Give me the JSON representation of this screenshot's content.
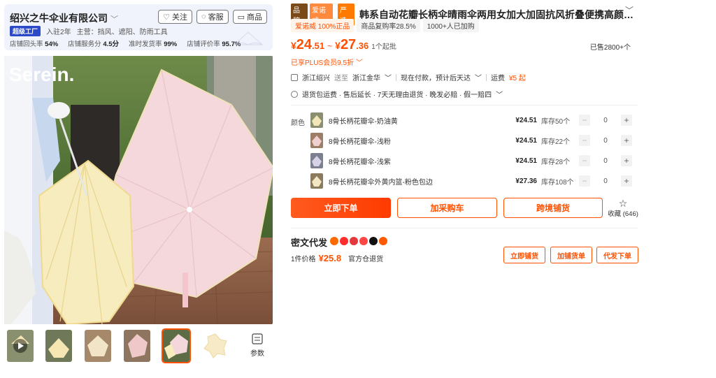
{
  "shop": {
    "name": "绍兴之牛伞业有限公司",
    "follow_label": "关注",
    "service_label": "客服",
    "store_label": "商品",
    "badge": "超级工厂",
    "years": "入驻2年",
    "main_business": "主营：挡风、遮阳、防雨工具",
    "stats": [
      {
        "label": "店铺回头率",
        "value": "54%"
      },
      {
        "label": "店铺服务分",
        "value": "4.5分"
      },
      {
        "label": "准时发货率",
        "value": "99%"
      },
      {
        "label": "店铺评价率",
        "value": "95.7%"
      }
    ]
  },
  "gallery": {
    "watermark": "Serein.",
    "param_label": "参数",
    "active_thumb": 4
  },
  "product": {
    "tag_brand": "品牌",
    "tag_brandname": "爱诺威",
    "tag_yanxuan": "严选",
    "title": "韩系自动花瓣长柄伞晴雨伞两用女加大加固抗风折叠便携高颜…",
    "chips": [
      "爱诺威 100%正品",
      "商品复购率28.5%",
      "1000+人已加购"
    ],
    "price_low_int": "24",
    "price_low_dec": ".51",
    "price_high_int": "27",
    "price_high_dec": ".36",
    "price_symbol": "¥",
    "price_sep": "~",
    "moq": "1个起批",
    "sold": "已售2800+个",
    "plus_text": "已享PLUS会员9.5折"
  },
  "logistics": {
    "from": "浙江绍兴",
    "to_prefix": "送至",
    "to": "浙江金华",
    "delivery": "现在付款，预计后天达",
    "shipping_label": "运费",
    "shipping_value": "¥5 起",
    "services": "退货包运费 · 售后延长 · 7天无理由退货 · 晚发必赔 · 假一赔四"
  },
  "sku": {
    "label": "颜色",
    "items": [
      {
        "name": "8骨长柄花瓣伞-奶油黄",
        "price": "¥24.51",
        "stock": "库存50个",
        "qty": "0",
        "color": "#f3e6b8"
      },
      {
        "name": "8骨长柄花瓣伞-浅粉",
        "price": "¥24.51",
        "stock": "库存22个",
        "qty": "0",
        "color": "#f0cfcf"
      },
      {
        "name": "8骨长柄花瓣伞-浅紫",
        "price": "¥24.51",
        "stock": "库存28个",
        "qty": "0",
        "color": "#d8d2e6"
      },
      {
        "name": "8骨长柄花瓣伞外黄内篮-粉色包边",
        "price": "¥27.36",
        "stock": "库存108个",
        "qty": "0",
        "color": "#f2e7c2"
      }
    ]
  },
  "actions": {
    "buy_now": "立即下单",
    "add_cart": "加采购车",
    "cross_border": "跨境铺货",
    "favorite": "收藏 (646)"
  },
  "dropship": {
    "title": "密文代发",
    "price_label": "1件价格",
    "price": "¥25.8",
    "return_note": "官方仓退货",
    "btn_list": "立即铺货",
    "btn_add": "加铺货单",
    "btn_order": "代发下单"
  }
}
